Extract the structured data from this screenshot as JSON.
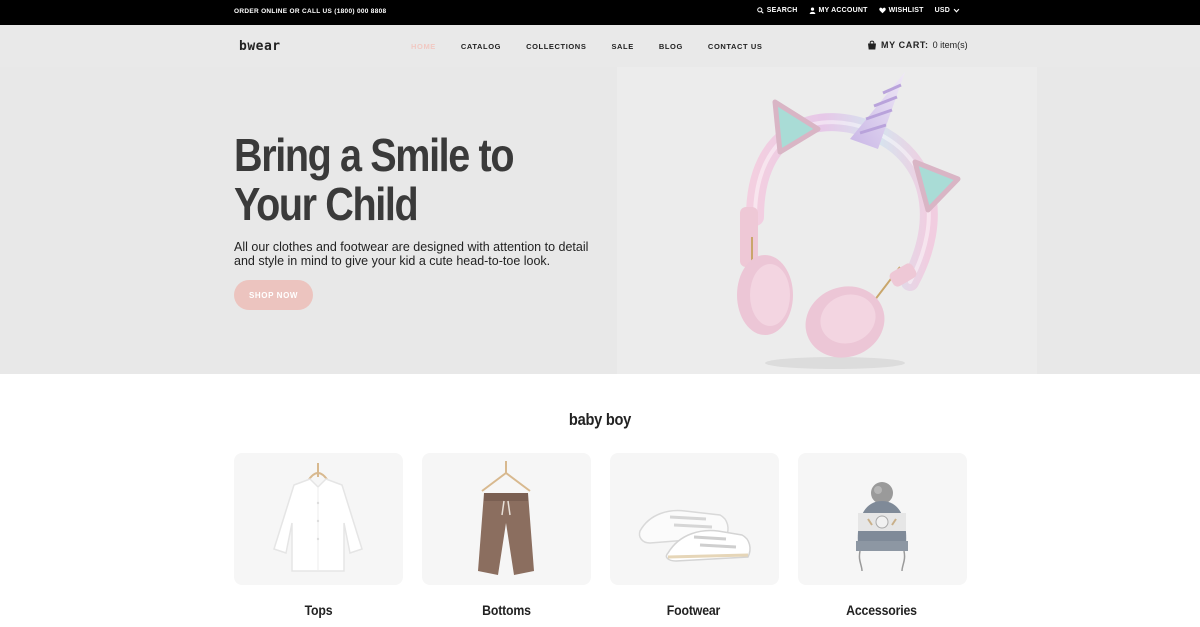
{
  "topbar": {
    "promo": "ORDER ONLINE OR CALL US (1800) 000 8808",
    "search": "SEARCH",
    "account": "MY ACCOUNT",
    "wishlist": "WISHLIST",
    "currency": "USD"
  },
  "header": {
    "logo": "bwear",
    "nav": [
      "HOME",
      "CATALOG",
      "COLLECTIONS",
      "SALE",
      "BLOG",
      "CONTACT US"
    ],
    "active_nav": "HOME",
    "cart_label": "MY CART:",
    "cart_count": "0 item(s)"
  },
  "hero": {
    "title": "Bring a Smile to Your Child",
    "description": "All our clothes and footwear are designed with attention to detail and style in mind to give your kid a cute head-to-toe look.",
    "button": "SHOP NOW"
  },
  "categories": {
    "title": "baby boy",
    "items": [
      "Tops",
      "Bottoms",
      "Footwear",
      "Accessories"
    ]
  },
  "colors": {
    "accent": "#ecc4bf",
    "topbar": "#000000",
    "hero_bg": "#e8e8e8"
  }
}
